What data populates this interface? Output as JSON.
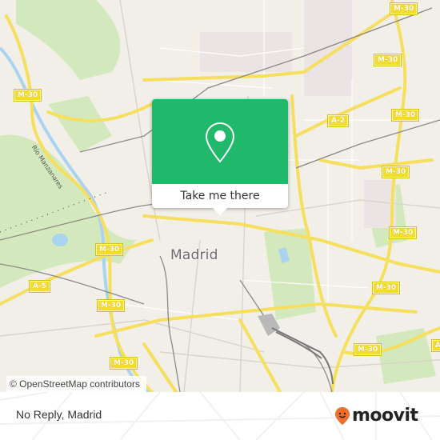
{
  "map": {
    "city_label": "Madrid",
    "river_label": "Río Manzanares",
    "road_shields": [
      {
        "label": "M-30",
        "pos": "top-center-right"
      },
      {
        "label": "M-30",
        "pos": "left-upper"
      },
      {
        "label": "M-30",
        "pos": "right-1"
      },
      {
        "label": "M-30",
        "pos": "right-2"
      },
      {
        "label": "A-2",
        "pos": "right-a2"
      },
      {
        "label": "M-30",
        "pos": "right-3"
      },
      {
        "label": "M-30",
        "pos": "right-4"
      },
      {
        "label": "M-30",
        "pos": "right-5"
      },
      {
        "label": "M-30",
        "pos": "lower-right"
      },
      {
        "label": "M-30",
        "pos": "left-mid"
      },
      {
        "label": "A-5",
        "pos": "left-a5"
      },
      {
        "label": "M-30",
        "pos": "left-lower"
      },
      {
        "label": "M-30",
        "pos": "bottom-left"
      },
      {
        "label": "A",
        "pos": "far-right-edge"
      }
    ],
    "attribution": "© OpenStreetMap contributors",
    "colors": {
      "background": "#f2efe9",
      "park": "#cfe8b4",
      "water": "#a9d3f0",
      "motorway": "#f7e36a",
      "rail": "#8a8a8a"
    }
  },
  "popup": {
    "icon": "map-pin-icon",
    "button_label": "Take me there",
    "accent_color": "#20b86a"
  },
  "footer": {
    "place_name": "No Reply, Madrid",
    "brand": {
      "logo_icon": "moovit-smiley-pin-icon",
      "name": "moovit",
      "accent_color": "#f26c2a"
    }
  }
}
